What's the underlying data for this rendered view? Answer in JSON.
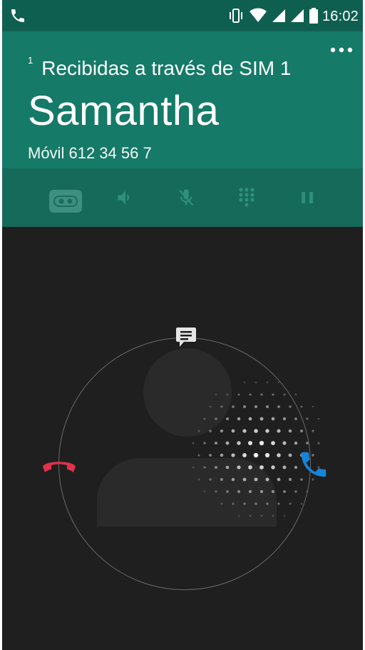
{
  "status_bar": {
    "time": "16:02",
    "icons": [
      "phone-icon",
      "vibrate-icon",
      "wifi-icon",
      "signal-icon",
      "signal-icon",
      "battery-icon"
    ]
  },
  "call_header": {
    "sim_index": "1",
    "sim_text": "Recibidas a través de SIM 1",
    "caller_name": "Samantha",
    "number_type": "Móvil",
    "number": "612 34 56 7"
  },
  "controls": [
    "voicemail-icon",
    "speaker-icon",
    "mute-icon",
    "dialpad-icon",
    "pause-icon"
  ],
  "colors": {
    "header": "#167a68",
    "status": "#0f5f50",
    "decline": "#e0314d",
    "answer": "#1584d9"
  }
}
